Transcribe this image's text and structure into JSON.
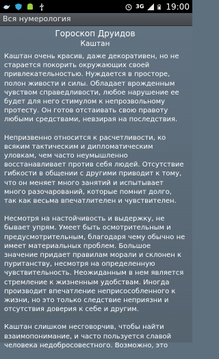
{
  "status_bar": {
    "time": "19:00",
    "network": "3G",
    "icons": [
      "bird-icon",
      "shield-icon",
      "android-icon",
      "usb-icon",
      "alarm-icon",
      "signal-icon",
      "battery-icon"
    ]
  },
  "app": {
    "title": "Вся нумерология"
  },
  "article": {
    "heading": "Гороскоп Друидов",
    "subheading": "Каштан",
    "paragraphs": [
      "Каштан очень красив, даже декоративен, но не старается покорить окружающих своей привлекательностью. Нуждается в просторе, полон живости и силы. Обладает врожденным чувством справедливости, любое нарушение ее будет для него стимулом к непрозвольному протесту. Он готов отстаивать свою правоту любыми средствами, невзирая на последствия.",
      "Непризвенно относится к расчетливости, ко всяким тактическим и дипломатическим уловкам, чем часто неумышленно восстанавливает против себя людей. Отсутствие гибкости в общении с другими приводит к тому, что он меняет много занятий и испытывает много разочарований, которые помнит долго, так как весьма впечатлителен и чувствителен.",
      "Несмотря на настойчивость и выдержку, не бывает упрям. Умеет быть осмотрительным и предусмотрительным, благодаря чему обычно не имеет материальных проблем. Большое значение придает правилам морали и склонен к пуританству, несмотря на определенную чувствительность. Неожиданным в нем является стремление к жизненным удобствам. Иногда производит впечатление неприсособленного к жизни, но это только следствие неприязни и отсутствия доверия к себе и другим.",
      "Каштан слишком несговорчив, чтобы найти взаимопонимание, и часто пользуется славой человека недобросовестного. Возможно, это"
    ]
  }
}
